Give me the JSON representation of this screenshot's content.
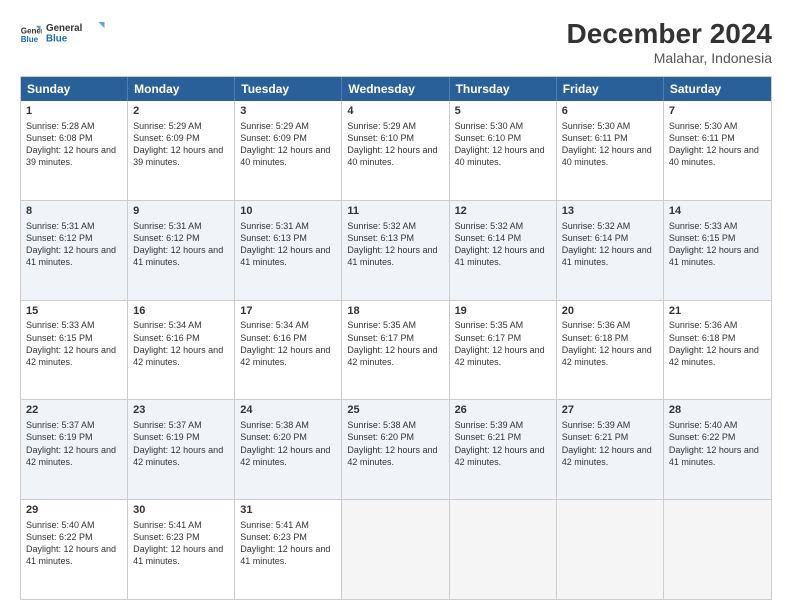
{
  "logo": {
    "line1": "General",
    "line2": "Blue"
  },
  "title": "December 2024",
  "subtitle": "Malahar, Indonesia",
  "header_days": [
    "Sunday",
    "Monday",
    "Tuesday",
    "Wednesday",
    "Thursday",
    "Friday",
    "Saturday"
  ],
  "rows": [
    [
      {
        "day": "1",
        "sr": "Sunrise: 5:28 AM",
        "ss": "Sunset: 6:08 PM",
        "dl": "Daylight: 12 hours and 39 minutes."
      },
      {
        "day": "2",
        "sr": "Sunrise: 5:29 AM",
        "ss": "Sunset: 6:09 PM",
        "dl": "Daylight: 12 hours and 39 minutes."
      },
      {
        "day": "3",
        "sr": "Sunrise: 5:29 AM",
        "ss": "Sunset: 6:09 PM",
        "dl": "Daylight: 12 hours and 40 minutes."
      },
      {
        "day": "4",
        "sr": "Sunrise: 5:29 AM",
        "ss": "Sunset: 6:10 PM",
        "dl": "Daylight: 12 hours and 40 minutes."
      },
      {
        "day": "5",
        "sr": "Sunrise: 5:30 AM",
        "ss": "Sunset: 6:10 PM",
        "dl": "Daylight: 12 hours and 40 minutes."
      },
      {
        "day": "6",
        "sr": "Sunrise: 5:30 AM",
        "ss": "Sunset: 6:11 PM",
        "dl": "Daylight: 12 hours and 40 minutes."
      },
      {
        "day": "7",
        "sr": "Sunrise: 5:30 AM",
        "ss": "Sunset: 6:11 PM",
        "dl": "Daylight: 12 hours and 40 minutes."
      }
    ],
    [
      {
        "day": "8",
        "sr": "Sunrise: 5:31 AM",
        "ss": "Sunset: 6:12 PM",
        "dl": "Daylight: 12 hours and 41 minutes."
      },
      {
        "day": "9",
        "sr": "Sunrise: 5:31 AM",
        "ss": "Sunset: 6:12 PM",
        "dl": "Daylight: 12 hours and 41 minutes."
      },
      {
        "day": "10",
        "sr": "Sunrise: 5:31 AM",
        "ss": "Sunset: 6:13 PM",
        "dl": "Daylight: 12 hours and 41 minutes."
      },
      {
        "day": "11",
        "sr": "Sunrise: 5:32 AM",
        "ss": "Sunset: 6:13 PM",
        "dl": "Daylight: 12 hours and 41 minutes."
      },
      {
        "day": "12",
        "sr": "Sunrise: 5:32 AM",
        "ss": "Sunset: 6:14 PM",
        "dl": "Daylight: 12 hours and 41 minutes."
      },
      {
        "day": "13",
        "sr": "Sunrise: 5:32 AM",
        "ss": "Sunset: 6:14 PM",
        "dl": "Daylight: 12 hours and 41 minutes."
      },
      {
        "day": "14",
        "sr": "Sunrise: 5:33 AM",
        "ss": "Sunset: 6:15 PM",
        "dl": "Daylight: 12 hours and 41 minutes."
      }
    ],
    [
      {
        "day": "15",
        "sr": "Sunrise: 5:33 AM",
        "ss": "Sunset: 6:15 PM",
        "dl": "Daylight: 12 hours and 42 minutes."
      },
      {
        "day": "16",
        "sr": "Sunrise: 5:34 AM",
        "ss": "Sunset: 6:16 PM",
        "dl": "Daylight: 12 hours and 42 minutes."
      },
      {
        "day": "17",
        "sr": "Sunrise: 5:34 AM",
        "ss": "Sunset: 6:16 PM",
        "dl": "Daylight: 12 hours and 42 minutes."
      },
      {
        "day": "18",
        "sr": "Sunrise: 5:35 AM",
        "ss": "Sunset: 6:17 PM",
        "dl": "Daylight: 12 hours and 42 minutes."
      },
      {
        "day": "19",
        "sr": "Sunrise: 5:35 AM",
        "ss": "Sunset: 6:17 PM",
        "dl": "Daylight: 12 hours and 42 minutes."
      },
      {
        "day": "20",
        "sr": "Sunrise: 5:36 AM",
        "ss": "Sunset: 6:18 PM",
        "dl": "Daylight: 12 hours and 42 minutes."
      },
      {
        "day": "21",
        "sr": "Sunrise: 5:36 AM",
        "ss": "Sunset: 6:18 PM",
        "dl": "Daylight: 12 hours and 42 minutes."
      }
    ],
    [
      {
        "day": "22",
        "sr": "Sunrise: 5:37 AM",
        "ss": "Sunset: 6:19 PM",
        "dl": "Daylight: 12 hours and 42 minutes."
      },
      {
        "day": "23",
        "sr": "Sunrise: 5:37 AM",
        "ss": "Sunset: 6:19 PM",
        "dl": "Daylight: 12 hours and 42 minutes."
      },
      {
        "day": "24",
        "sr": "Sunrise: 5:38 AM",
        "ss": "Sunset: 6:20 PM",
        "dl": "Daylight: 12 hours and 42 minutes."
      },
      {
        "day": "25",
        "sr": "Sunrise: 5:38 AM",
        "ss": "Sunset: 6:20 PM",
        "dl": "Daylight: 12 hours and 42 minutes."
      },
      {
        "day": "26",
        "sr": "Sunrise: 5:39 AM",
        "ss": "Sunset: 6:21 PM",
        "dl": "Daylight: 12 hours and 42 minutes."
      },
      {
        "day": "27",
        "sr": "Sunrise: 5:39 AM",
        "ss": "Sunset: 6:21 PM",
        "dl": "Daylight: 12 hours and 42 minutes."
      },
      {
        "day": "28",
        "sr": "Sunrise: 5:40 AM",
        "ss": "Sunset: 6:22 PM",
        "dl": "Daylight: 12 hours and 41 minutes."
      }
    ],
    [
      {
        "day": "29",
        "sr": "Sunrise: 5:40 AM",
        "ss": "Sunset: 6:22 PM",
        "dl": "Daylight: 12 hours and 41 minutes."
      },
      {
        "day": "30",
        "sr": "Sunrise: 5:41 AM",
        "ss": "Sunset: 6:23 PM",
        "dl": "Daylight: 12 hours and 41 minutes."
      },
      {
        "day": "31",
        "sr": "Sunrise: 5:41 AM",
        "ss": "Sunset: 6:23 PM",
        "dl": "Daylight: 12 hours and 41 minutes."
      },
      null,
      null,
      null,
      null
    ]
  ]
}
